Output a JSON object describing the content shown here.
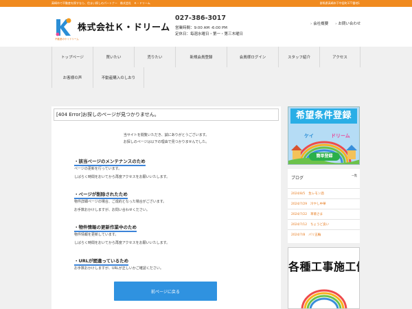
{
  "topbar": {
    "left_text": "高崎市で不動産を探すなら、住まい探しのパートナー　株式会社　Ｋ・ドリーム",
    "right_text": "群馬県高崎市下中居町377番地1"
  },
  "header": {
    "logo_caption": "不動産のケイドリーム",
    "company_name": "株式会社Ｋ・ドリーム",
    "phone": "027-386-3017",
    "hours": "営業時間：9:00 AM -6:00 PM",
    "holiday": "定休日：毎週水曜日・第一・第三木曜日",
    "links": [
      "会社概要",
      "お問い合わせ"
    ]
  },
  "nav": {
    "row1": [
      "トップページ",
      "買いたい",
      "売りたい",
      "新規会員登録",
      "会員様ログイン",
      "スタッフ紹介",
      "アクセス"
    ],
    "row2": [
      "お客様の声",
      "不動産購入のしおり"
    ]
  },
  "main": {
    "error_title": "[404 Error]お探しのページが見つかりません。",
    "intro_1": "当サイトを閲覧いただき、誠にありがとうございます。",
    "intro_2": "お探しのページは以下の理由で見つかりませんでした。",
    "reasons": [
      {
        "heading": "・該当ページのメンテナンスのため",
        "lines": [
          "ページの更新を行っています。",
          "しばらく時間をおいてから再度アクセスをお願いいたします。"
        ]
      },
      {
        "heading": "・ページが削除されたため",
        "lines": [
          "物件詳細ページの場合、ご成約となった場合がございます。",
          "お手数おかけしますが、お問い合わせください。"
        ]
      },
      {
        "heading": "・物件情報の更新作業中のため",
        "lines": [
          "物件情報を更新しています。",
          "しばらく時間をおいてから再度アクセスをお願いいたします。"
        ]
      },
      {
        "heading": "・URLが間違っているため",
        "lines": [
          "お手数おかけしますが、URLが正しいかご確認ください。"
        ]
      }
    ],
    "back_button": "前ページに戻る"
  },
  "sidebar": {
    "banner1_title": "希望条件登録",
    "banner1_pill": "簡単登録",
    "blog_title": "ブログ",
    "blog_more": "一覧",
    "blog_posts": [
      {
        "date": "2024/8/5",
        "title": "生レモン酒"
      },
      {
        "date": "2024/7/29",
        "title": "冷やし中華"
      },
      {
        "date": "2024/7/22",
        "title": "草菊さま"
      },
      {
        "date": "2024/7/12",
        "title": "ちょうど良い"
      },
      {
        "date": "2024/7/8",
        "title": "バリ五輪"
      }
    ],
    "banner2_title": "各種工事施工例"
  },
  "colors": {
    "accent_orange": "#f08a1f",
    "button_blue": "#2f92e0",
    "banner_blue": "#29aee6"
  }
}
